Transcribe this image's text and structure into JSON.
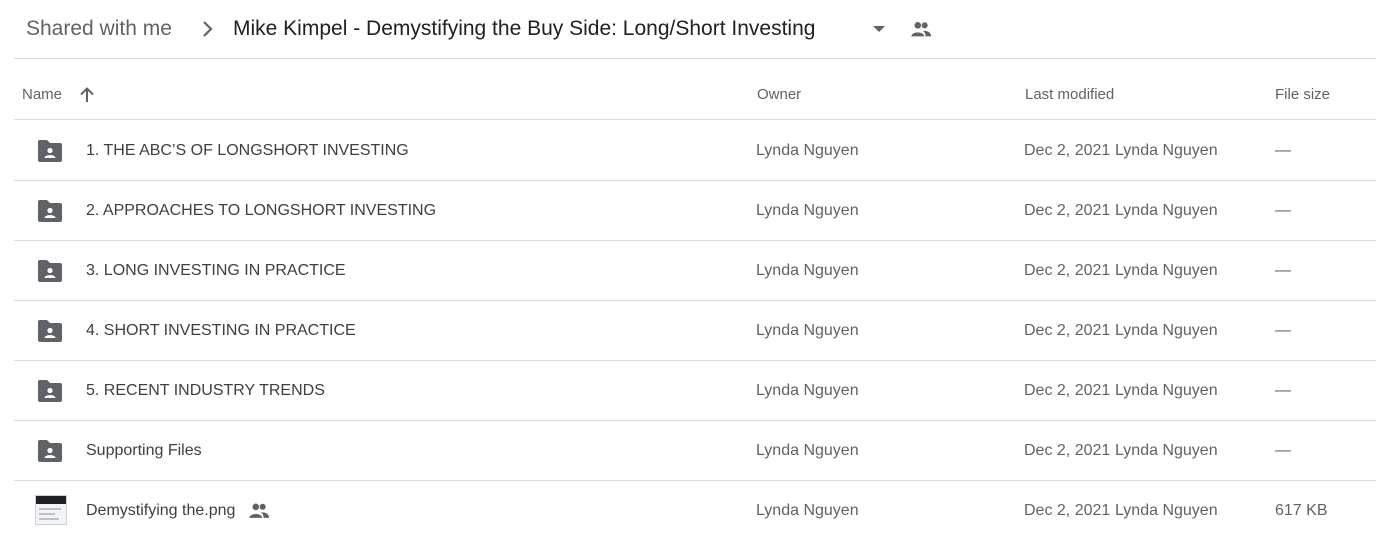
{
  "breadcrumb": {
    "root": "Shared with me",
    "current": "Mike Kimpel - Demystifying the Buy Side: Long/Short Investing"
  },
  "columns": {
    "name": "Name",
    "owner": "Owner",
    "modified": "Last modified",
    "size": "File size"
  },
  "rows": [
    {
      "name": "1. THE ABC’S OF LONGSHORT INVESTING",
      "owner": "Lynda Nguyen",
      "date": "Dec 2, 2021",
      "modified_by": "Lynda Nguyen",
      "size": "—",
      "icon": "shared-folder-icon"
    },
    {
      "name": "2. APPROACHES TO LONGSHORT INVESTING",
      "owner": "Lynda Nguyen",
      "date": "Dec 2, 2021",
      "modified_by": "Lynda Nguyen",
      "size": "—",
      "icon": "shared-folder-icon"
    },
    {
      "name": "3. LONG INVESTING IN PRACTICE",
      "owner": "Lynda Nguyen",
      "date": "Dec 2, 2021",
      "modified_by": "Lynda Nguyen",
      "size": "—",
      "icon": "shared-folder-icon"
    },
    {
      "name": "4. SHORT INVESTING IN PRACTICE",
      "owner": "Lynda Nguyen",
      "date": "Dec 2, 2021",
      "modified_by": "Lynda Nguyen",
      "size": "—",
      "icon": "shared-folder-icon"
    },
    {
      "name": "5. RECENT INDUSTRY TRENDS",
      "owner": "Lynda Nguyen",
      "date": "Dec 2, 2021",
      "modified_by": "Lynda Nguyen",
      "size": "—",
      "icon": "shared-folder-icon"
    },
    {
      "name": "Supporting Files",
      "owner": "Lynda Nguyen",
      "date": "Dec 2, 2021",
      "modified_by": "Lynda Nguyen",
      "size": "—",
      "icon": "shared-folder-icon"
    },
    {
      "name": "Demystifying the.png",
      "owner": "Lynda Nguyen",
      "date": "Dec 2, 2021",
      "modified_by": "Lynda Nguyen",
      "size": "617 KB",
      "icon": "image-thumbnail-icon"
    }
  ],
  "colors": {
    "text_primary": "#3c4043",
    "text_secondary": "#5f6368",
    "divider": "#dadce0",
    "icon": "#5f6368"
  }
}
